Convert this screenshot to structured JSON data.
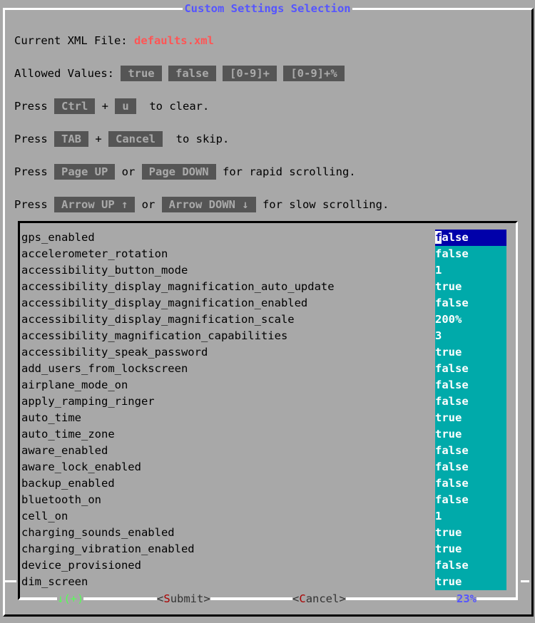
{
  "dialog": {
    "title": "Custom Settings Selection"
  },
  "info": {
    "current_file_label": "Current XML File: ",
    "current_file_name": "defaults.xml",
    "allowed_label": "Allowed Values: ",
    "allowed_values": [
      "true",
      "false",
      "[0-9]+",
      "[0-9]+%"
    ],
    "press": "Press ",
    "or": " or ",
    "plus": " + ",
    "clear": {
      "keys": [
        "Ctrl",
        "u"
      ],
      "suffix": "  to clear."
    },
    "skip": {
      "keys": [
        "TAB",
        "Cancel"
      ],
      "suffix": "  to skip."
    },
    "rapid": {
      "keys": [
        "Page UP",
        "Page DOWN"
      ],
      "suffix": " for rapid scrolling."
    },
    "slow": {
      "keys": [
        "Arrow UP ↑",
        "Arrow DOWN ↓"
      ],
      "suffix": " for slow scrolling."
    }
  },
  "settings": [
    {
      "key": "gps_enabled",
      "value": "false",
      "selected": true
    },
    {
      "key": "accelerometer_rotation",
      "value": "false"
    },
    {
      "key": "accessibility_button_mode",
      "value": "1"
    },
    {
      "key": "accessibility_display_magnification_auto_update",
      "value": "true"
    },
    {
      "key": "accessibility_display_magnification_enabled",
      "value": "false"
    },
    {
      "key": "accessibility_display_magnification_scale",
      "value": "200%"
    },
    {
      "key": "accessibility_magnification_capabilities",
      "value": "3"
    },
    {
      "key": "accessibility_speak_password",
      "value": "true"
    },
    {
      "key": "add_users_from_lockscreen",
      "value": "false"
    },
    {
      "key": "airplane_mode_on",
      "value": "false"
    },
    {
      "key": "apply_ramping_ringer",
      "value": "false"
    },
    {
      "key": "auto_time",
      "value": "true"
    },
    {
      "key": "auto_time_zone",
      "value": "true"
    },
    {
      "key": "aware_enabled",
      "value": "false"
    },
    {
      "key": "aware_lock_enabled",
      "value": "false"
    },
    {
      "key": "backup_enabled",
      "value": "false"
    },
    {
      "key": "bluetooth_on",
      "value": "false"
    },
    {
      "key": "cell_on",
      "value": "1"
    },
    {
      "key": "charging_sounds_enabled",
      "value": "true"
    },
    {
      "key": "charging_vibration_enabled",
      "value": "true"
    },
    {
      "key": "device_provisioned",
      "value": "false"
    },
    {
      "key": "dim_screen",
      "value": "true"
    }
  ],
  "footer": {
    "scroll_indicator": "↓(+)",
    "submit": {
      "open": "<",
      "hotkey": "S",
      "rest": "ubmit",
      "close": ">"
    },
    "cancel": {
      "open": "<",
      "hotkey": "C",
      "rest": "ancel",
      "close": ">"
    },
    "scroll_percent": "23%"
  },
  "colors": {
    "background": "#a8a8a8",
    "title": "#5555ff",
    "file_name": "#ff5555",
    "key_bg": "#555555",
    "key_fg": "#aaaaaa",
    "value_bg": "#00aaaa",
    "selected_bg": "#0000aa",
    "scroll_indicator": "#55ff55",
    "hotkey": "#aa0000"
  }
}
